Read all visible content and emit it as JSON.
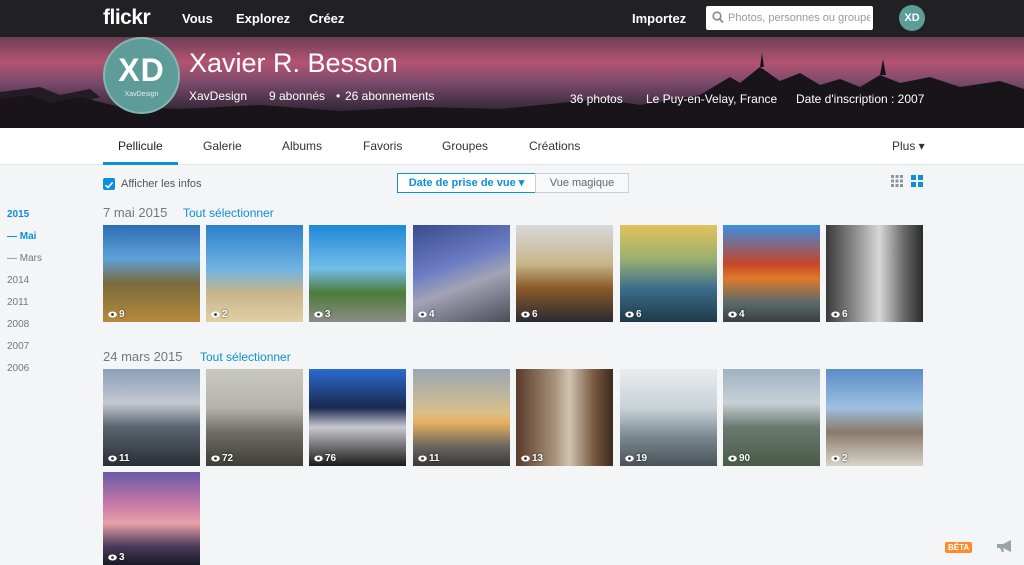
{
  "nav": {
    "logo": "flickr",
    "links": [
      "Vous",
      "Explorez",
      "Créez"
    ],
    "upload": "Importez",
    "search_placeholder": "Photos, personnes ou groupes",
    "avatar_initials": "XD"
  },
  "profile": {
    "monogram": "XD",
    "avatar_caption": "XavDesign",
    "name": "Xavier R. Besson",
    "username": "XavDesign",
    "followers": "9 abonnés",
    "separator": "•",
    "following": "26 abonnements",
    "photos": "36 photos",
    "location": "Le Puy-en-Velay, France",
    "joined": "Date d'inscription : 2007"
  },
  "tabs": [
    "Pellicule",
    "Galerie",
    "Albums",
    "Favoris",
    "Groupes",
    "Créations"
  ],
  "active_tab": "Pellicule",
  "more_label": "Plus ▾",
  "toolbar": {
    "show_info": "Afficher les infos",
    "show_info_checked": true,
    "sort_selected": "Date de prise de vue ▾",
    "sort_alt": "Vue magique"
  },
  "years": [
    "2015",
    "— Mai",
    "— Mars",
    "2014",
    "2011",
    "2008",
    "2007",
    "2006"
  ],
  "groups": [
    {
      "date": "7 mai 2015",
      "select_all": "Tout sélectionner",
      "photos": [
        {
          "views": "9"
        },
        {
          "views": "2"
        },
        {
          "views": "3"
        },
        {
          "views": "4"
        },
        {
          "views": "6"
        },
        {
          "views": "6"
        },
        {
          "views": "4"
        },
        {
          "views": "6"
        }
      ]
    },
    {
      "date": "24 mars 2015",
      "select_all": "Tout sélectionner",
      "photos": [
        {
          "views": "11"
        },
        {
          "views": "72"
        },
        {
          "views": "76"
        },
        {
          "views": "11"
        },
        {
          "views": "13"
        },
        {
          "views": "19"
        },
        {
          "views": "90"
        },
        {
          "views": "2"
        },
        {
          "views": "3"
        }
      ]
    }
  ],
  "beta_badge": "BÊTA",
  "colors": {
    "accent": "#0d8fd9",
    "nav_bg": "#212124",
    "beta": "#ff8a29"
  }
}
